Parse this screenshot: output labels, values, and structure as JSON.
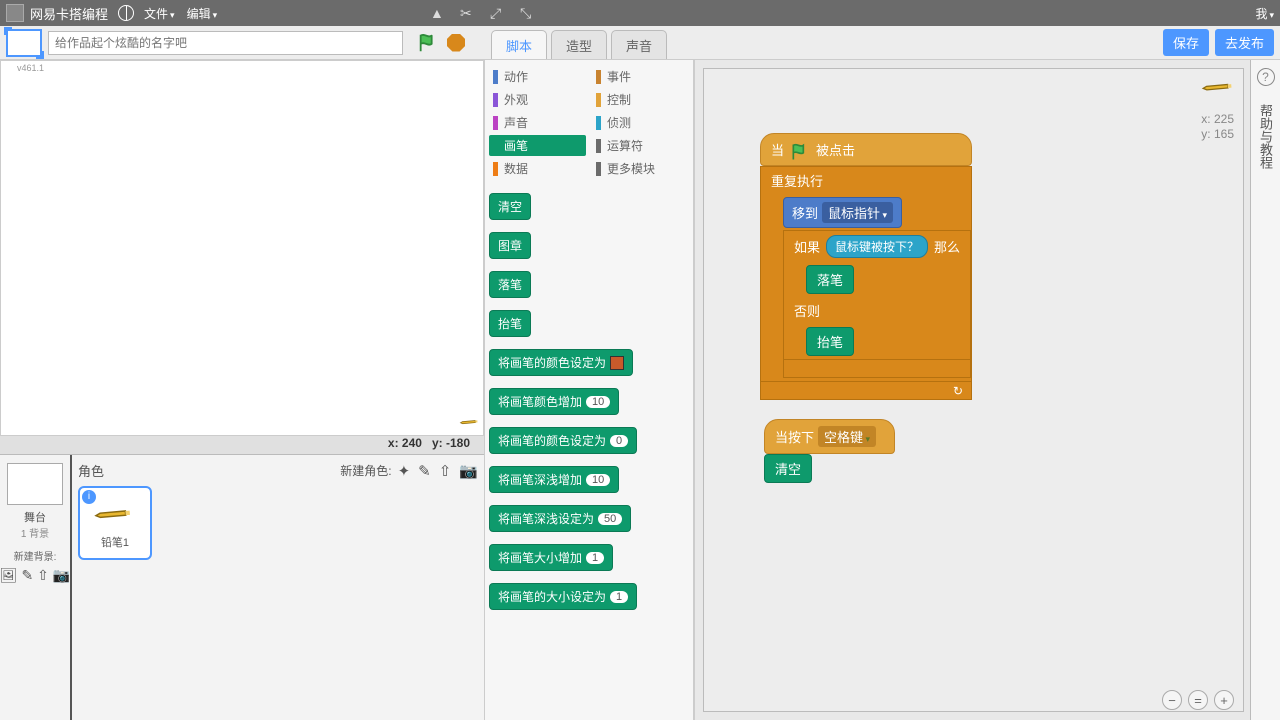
{
  "topbar": {
    "brand": "网易卡搭编程",
    "file": "文件",
    "edit": "编辑",
    "me": "我"
  },
  "row2": {
    "placeholder": "给作品起个炫酷的名字吧",
    "tabs": {
      "scripts": "脚本",
      "costumes": "造型",
      "sounds": "声音"
    },
    "save": "保存",
    "publish": "去发布"
  },
  "stage": {
    "version": "v461.1",
    "coord_x_label": "x:",
    "coord_x": "240",
    "coord_y_label": "y:",
    "coord_y": "-180"
  },
  "stagecol": {
    "stage": "舞台",
    "bg_count": "1 背景",
    "newbg": "新建背景:"
  },
  "sprites": {
    "title": "角色",
    "new": "新建角色:",
    "sprite1": "铅笔1"
  },
  "categories": {
    "motion": "动作",
    "events": "事件",
    "looks": "外观",
    "control": "控制",
    "sound": "声音",
    "sensing": "侦测",
    "pen": "画笔",
    "operators": "运算符",
    "data": "数据",
    "more": "更多模块"
  },
  "cat_colors": {
    "motion": "#4d7cc9",
    "events": "#c88330",
    "looks": "#8a55d7",
    "control": "#e1a33a",
    "sound": "#bb42c3",
    "sensing": "#2ca4c9",
    "pen": "#0e9a6c",
    "operators": "#5cb712",
    "data": "#ee7d16",
    "more": "#6b6b6b"
  },
  "palette": {
    "clear": "清空",
    "stamp": "图章",
    "pendown": "落笔",
    "penup": "抬笔",
    "setcolor": "将画笔的颜色设定为",
    "changecolor": "将画笔颜色增加",
    "changecolor_v": "10",
    "setcolornum": "将画笔的颜色设定为",
    "setcolornum_v": "0",
    "changeshade": "将画笔深浅增加",
    "changeshade_v": "10",
    "setshade": "将画笔深浅设定为",
    "setshade_v": "50",
    "changesize": "将画笔大小增加",
    "changesize_v": "1",
    "setsize": "将画笔的大小设定为",
    "setsize_v": "1"
  },
  "script": {
    "when": "当",
    "clicked": "被点击",
    "forever": "重复执行",
    "goto": "移到",
    "mouse": "鼠标指针",
    "if": "如果",
    "mousedown": "鼠标键被按下？",
    "then": "那么",
    "pendown": "落笔",
    "else": "否则",
    "penup": "抬笔",
    "whenkey": "当按下",
    "space": "空格键",
    "clear": "清空"
  },
  "scriptarea": {
    "x_label": "x:",
    "x": "225",
    "y_label": "y:",
    "y": "165"
  },
  "help": {
    "text": "帮助与教程"
  }
}
